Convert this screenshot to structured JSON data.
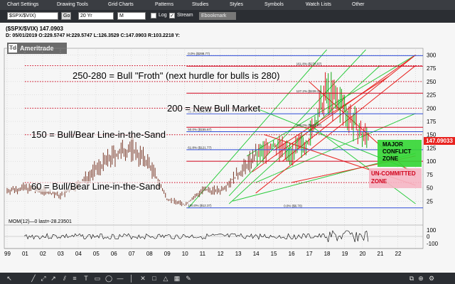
{
  "menu": [
    "Chart Settings",
    "Drawing Tools",
    "Grid Charts",
    "Patterns",
    "Studies",
    "Styles",
    "Symbols",
    "Watch Lists",
    "Other"
  ],
  "toolbar": {
    "symbol": "$SPX/$VIX)",
    "go": "Go",
    "period": "20 Yr",
    "interval": "M",
    "log_label": "Log",
    "stream_label": "Stream",
    "stream_checked": "✓",
    "extra": "Ebookmark"
  },
  "header": {
    "title": "($SPX/$VIX)   147.0903",
    "ohlc": "D: 05/01/2019  O:229.5747  H:229.5747  L:126.3529  C:147.0903          R:103.2218  Y:"
  },
  "logo": {
    "mark": "Td",
    "text": "Ameritrade"
  },
  "annotations": {
    "froth": "250-280 = Bull \"Froth\" (next hurdle for bulls is 280)",
    "new_bull": "200 = New Bull Market",
    "line_in_sand": "150 = Bull/Bear Line-in-the-Sand",
    "line_60": "60 = Bull/Bear Line-in-the-Sand",
    "major_conflict": [
      "MAJOR",
      "CONFLICT",
      "ZONE"
    ],
    "uncommitted": [
      "UN-COMMITTED",
      "ZONE"
    ]
  },
  "fib_labels": [
    "0.0% ($298.77)",
    "161.8% ($278.97)",
    "127.2% ($228.11)",
    "38.2% ($189.38)",
    "100.0% ($163.97)",
    "50.0% ($155.67)",
    "61.8% ($121.77)",
    "0.0% ($6.70)",
    "100.0% ($12.37)"
  ],
  "price_axis": [
    "300",
    "275",
    "250",
    "225",
    "200",
    "175",
    "150",
    "125",
    "100",
    "75",
    "50",
    "25"
  ],
  "last_price": "147.09033",
  "momentum": {
    "label": "MOM(12)—0 last=-28.23501",
    "ticks": [
      "100",
      "0",
      "-100"
    ]
  },
  "x_axis": [
    "99",
    "01",
    "02",
    "03",
    "04",
    "05",
    "06",
    "07",
    "08",
    "09",
    "10",
    "11",
    "12",
    "13",
    "14",
    "15",
    "16",
    "17",
    "18",
    "19",
    "20",
    "21",
    "22"
  ],
  "colors": {
    "accent_green": "#2ecc40",
    "zone_green": "#33d633",
    "zone_pink": "#f6b6c4",
    "price_tag": "#e8231f"
  },
  "chart_data": {
    "type": "bar",
    "title": "($SPX/$VIX)",
    "ylim": [
      0,
      310
    ],
    "x": [
      "1999",
      "2000",
      "2001",
      "2002",
      "2003",
      "2004",
      "2005",
      "2006",
      "2007",
      "2008",
      "2009",
      "2010",
      "2011",
      "2012",
      "2013",
      "2014",
      "2015",
      "2016",
      "2017",
      "2018",
      "2019"
    ],
    "values": [
      45,
      50,
      45,
      35,
      55,
      85,
      110,
      125,
      95,
      30,
      18,
      45,
      45,
      75,
      110,
      130,
      115,
      140,
      230,
      200,
      147
    ],
    "horizontal_levels": [
      280,
      250,
      200,
      150,
      60
    ]
  }
}
